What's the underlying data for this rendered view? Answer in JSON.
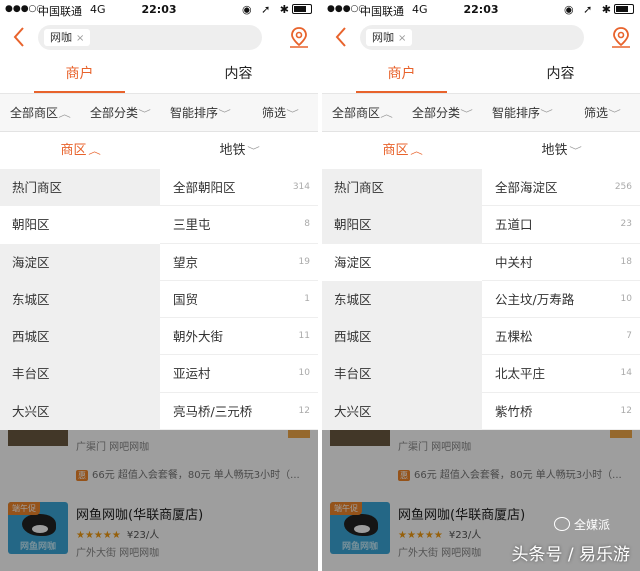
{
  "status": {
    "signal": "●●●○○",
    "carrier": "中国联通",
    "network": "4G",
    "time": "22:03",
    "icons": "◉ ➚ ✱"
  },
  "header": {
    "search_tag": "网咖",
    "tag_close": "×"
  },
  "main_tabs": [
    "商户",
    "内容"
  ],
  "filters": [
    "全部商区",
    "全部分类",
    "智能排序",
    "筛选"
  ],
  "sub_tabs": [
    "商区",
    "地铁"
  ],
  "districts": [
    "热门商区",
    "朝阳区",
    "海淀区",
    "东城区",
    "西城区",
    "丰台区",
    "大兴区"
  ],
  "panels": [
    {
      "selected_district_index": 1,
      "areas": [
        {
          "name": "全部朝阳区",
          "count": "314"
        },
        {
          "name": "三里屯",
          "count": "8"
        },
        {
          "name": "望京",
          "count": "19"
        },
        {
          "name": "国贸",
          "count": "1"
        },
        {
          "name": "朝外大街",
          "count": "11"
        },
        {
          "name": "亚运村",
          "count": "10"
        },
        {
          "name": "亮马桥/三元桥",
          "count": "12"
        }
      ]
    },
    {
      "selected_district_index": 2,
      "areas": [
        {
          "name": "全部海淀区",
          "count": "256"
        },
        {
          "name": "五道口",
          "count": "23"
        },
        {
          "name": "中关村",
          "count": "18"
        },
        {
          "name": "公主坟/万寿路",
          "count": "10"
        },
        {
          "name": "五棵松",
          "count": "7"
        },
        {
          "name": "北太平庄",
          "count": "14"
        },
        {
          "name": "紫竹桥",
          "count": "12"
        }
      ]
    }
  ],
  "results": {
    "partial_meta": "广渠门  网吧网咖",
    "deal_badge": "惠",
    "deal_text": "66元 超值入会套餐，80元 单人畅玩3小时（...",
    "shop_title": "网鱼网咖(华联商厦店)",
    "shop_stars": "★★★★★",
    "shop_price": "¥23/人",
    "shop_meta": "广外大街  网吧网咖",
    "promo_badge": "端午促",
    "thumb_text": "网鱼网咖"
  },
  "watermark": {
    "small": "全媒派",
    "large": "头条号 / 易乐游"
  },
  "colors": {
    "accent": "#e8632c",
    "overlay": "rgba(0,0,0,0.38)"
  }
}
